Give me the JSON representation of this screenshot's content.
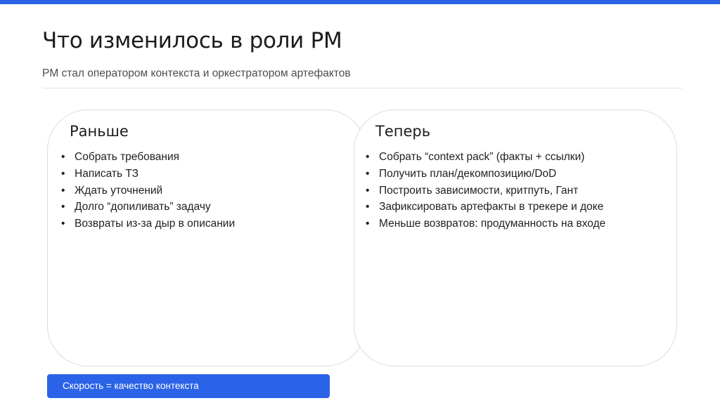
{
  "slide": {
    "title": "Что изменилось в роли PM",
    "subtitle": "PM стал оператором контекста и оркестратором артефактов",
    "accent_color": "#2b63e8"
  },
  "before": {
    "heading": "Раньше",
    "items": [
      "Собрать требования",
      "Написать ТЗ",
      "Ждать уточнений",
      "Долго “допиливать” задачу",
      "Возвраты из-за дыр в описании"
    ]
  },
  "after": {
    "heading": "Теперь",
    "items": [
      "Собрать “context pack” (факты + ссылки)",
      "Получить план/декомпозицию/DoD",
      "Построить зависимости, критпуть, Гант",
      "Зафиксировать артефакты в трекере и доке",
      "Меньше возвратов: продуманность на входе"
    ]
  },
  "callout": {
    "text": "Скорость = качество контекста"
  }
}
